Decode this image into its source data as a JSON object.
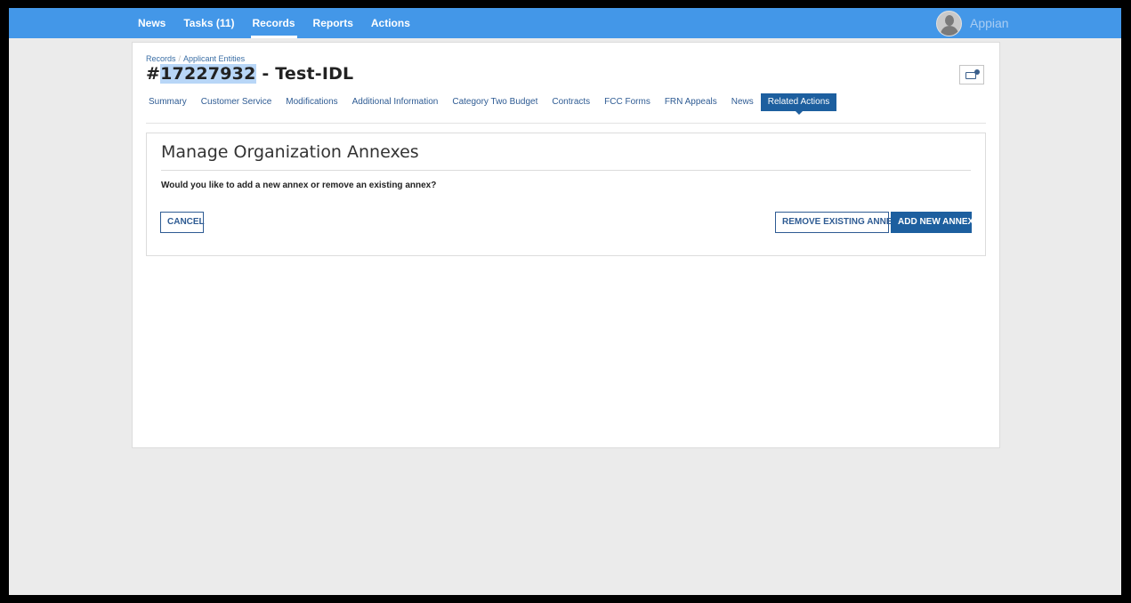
{
  "topbar": {
    "nav": [
      "News",
      "Tasks (11)",
      "Records",
      "Reports",
      "Actions"
    ],
    "active_nav": "Records",
    "brand": "Appian"
  },
  "record": {
    "breadcrumb": [
      "Records",
      "Applicant Entities"
    ],
    "title_prefix": "#",
    "title_id": "17227932",
    "title_suffix": " - Test-IDL"
  },
  "tabs": [
    "Summary",
    "Customer Service",
    "Modifications",
    "Additional Information",
    "Category Two Budget",
    "Contracts",
    "FCC Forms",
    "FRN Appeals",
    "News",
    "Related Actions"
  ],
  "active_tab": "Related Actions",
  "form": {
    "title": "Manage Organization Annexes",
    "question": "Would you like to add a new annex or remove an existing annex?",
    "cancel_label": "CANCEL",
    "remove_label": "REMOVE EXISTING ANNEX",
    "add_label": "ADD NEW ANNEX"
  },
  "colors": {
    "topbar": "#4397e8",
    "primary": "#1d5f9f",
    "link": "#2e5b93"
  }
}
